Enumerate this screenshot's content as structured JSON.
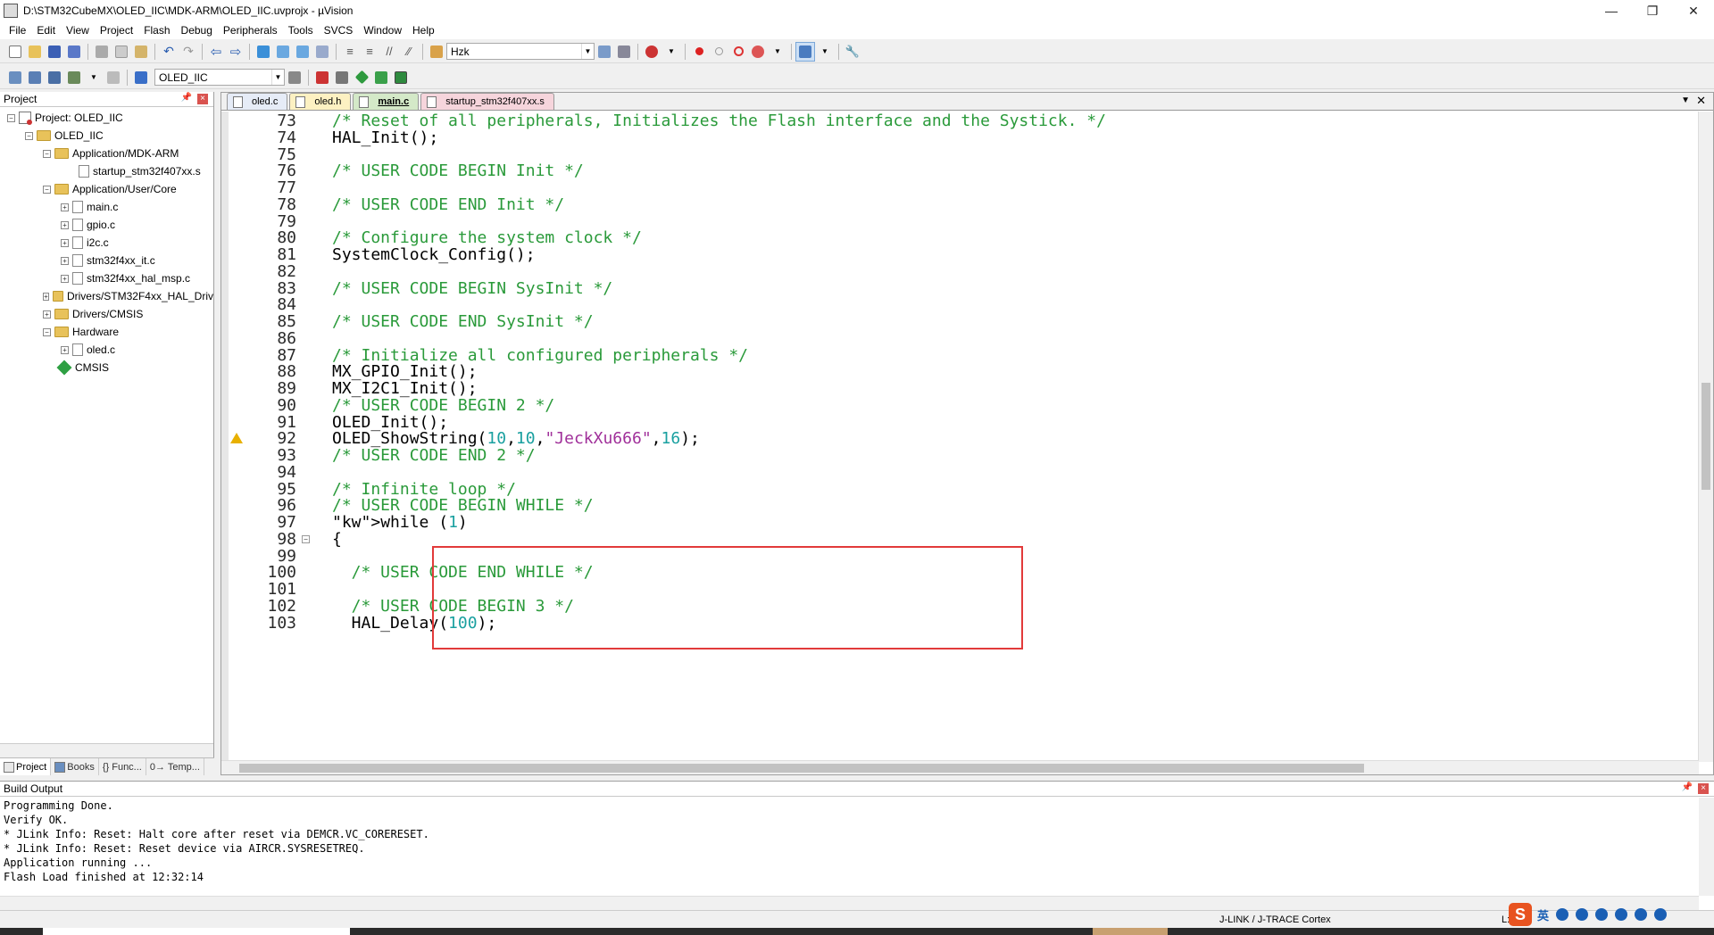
{
  "window": {
    "title": "D:\\STM32CubeMX\\OLED_IIC\\MDK-ARM\\OLED_IIC.uvprojx - µVision",
    "minimize": "—",
    "restore": "❐",
    "close": "✕"
  },
  "menu": [
    "File",
    "Edit",
    "View",
    "Project",
    "Flash",
    "Debug",
    "Peripherals",
    "Tools",
    "SVCS",
    "Window",
    "Help"
  ],
  "toolbar": {
    "find_value": "Hzk",
    "target_value": "OLED_IIC"
  },
  "project_panel": {
    "title": "Project",
    "tree": [
      {
        "label": "Project: OLED_IIC",
        "icon": "project-icon"
      },
      {
        "label": "OLED_IIC",
        "icon": "folder-icon"
      },
      {
        "label": "Application/MDK-ARM",
        "icon": "folder-icon"
      },
      {
        "label": "startup_stm32f407xx.s",
        "icon": "file-icon"
      },
      {
        "label": "Application/User/Core",
        "icon": "folder-icon"
      },
      {
        "label": "main.c",
        "icon": "file-icon"
      },
      {
        "label": "gpio.c",
        "icon": "file-icon"
      },
      {
        "label": "i2c.c",
        "icon": "file-icon"
      },
      {
        "label": "stm32f4xx_it.c",
        "icon": "file-icon"
      },
      {
        "label": "stm32f4xx_hal_msp.c",
        "icon": "file-icon"
      },
      {
        "label": "Drivers/STM32F4xx_HAL_Driv",
        "icon": "folder-icon"
      },
      {
        "label": "Drivers/CMSIS",
        "icon": "folder-icon"
      },
      {
        "label": "Hardware",
        "icon": "folder-icon"
      },
      {
        "label": "oled.c",
        "icon": "file-icon"
      },
      {
        "label": "CMSIS",
        "icon": "gem-icon"
      }
    ],
    "tabs": [
      "Project",
      "Books",
      "{} Func...",
      "0→ Temp..."
    ]
  },
  "editor": {
    "tabs": [
      "oled.c",
      "oled.h",
      "main.c",
      "startup_stm32f407xx.s"
    ],
    "active_tab": "main.c",
    "lines": [
      {
        "n": "73",
        "text": "/* Reset of all peripherals, Initializes the Flash interface and the Systick. */"
      },
      {
        "n": "74",
        "text": "HAL_Init();"
      },
      {
        "n": "75",
        "text": ""
      },
      {
        "n": "76",
        "text": "/* USER CODE BEGIN Init */"
      },
      {
        "n": "77",
        "text": ""
      },
      {
        "n": "78",
        "text": "/* USER CODE END Init */"
      },
      {
        "n": "79",
        "text": ""
      },
      {
        "n": "80",
        "text": "/* Configure the system clock */"
      },
      {
        "n": "81",
        "text": "SystemClock_Config();"
      },
      {
        "n": "82",
        "text": ""
      },
      {
        "n": "83",
        "text": "/* USER CODE BEGIN SysInit */"
      },
      {
        "n": "84",
        "text": ""
      },
      {
        "n": "85",
        "text": "/* USER CODE END SysInit */"
      },
      {
        "n": "86",
        "text": ""
      },
      {
        "n": "87",
        "text": "/* Initialize all configured peripherals */"
      },
      {
        "n": "88",
        "text": "MX_GPIO_Init();"
      },
      {
        "n": "89",
        "text": "MX_I2C1_Init();"
      },
      {
        "n": "90",
        "text": "/* USER CODE BEGIN 2 */"
      },
      {
        "n": "91",
        "text": "OLED_Init();"
      },
      {
        "n": "92",
        "text": "OLED_ShowString(10,10,\"JeckXu666\",16);"
      },
      {
        "n": "93",
        "text": "/* USER CODE END 2 */"
      },
      {
        "n": "94",
        "text": ""
      },
      {
        "n": "95",
        "text": "/* Infinite loop */"
      },
      {
        "n": "96",
        "text": "/* USER CODE BEGIN WHILE */"
      },
      {
        "n": "97",
        "text": "while (1)"
      },
      {
        "n": "98",
        "text": "{"
      },
      {
        "n": "99",
        "text": ""
      },
      {
        "n": "100",
        "text": "  /* USER CODE END WHILE */"
      },
      {
        "n": "101",
        "text": ""
      },
      {
        "n": "102",
        "text": "  /* USER CODE BEGIN 3 */"
      },
      {
        "n": "103",
        "text": "  HAL_Delay(100);"
      }
    ]
  },
  "build_output": {
    "title": "Build Output",
    "lines": [
      "Programming Done.",
      "Verify OK.",
      "* JLink Info: Reset: Halt core after reset via DEMCR.VC_CORERESET.",
      "* JLink Info: Reset: Reset device via AIRCR.SYSRESETREQ.",
      "Application running ...",
      "Flash Load finished at 12:32:14"
    ]
  },
  "status": {
    "debugger": "J-LINK / J-TRACE Cortex",
    "position": "L:1",
    "ime_lang": "英"
  }
}
